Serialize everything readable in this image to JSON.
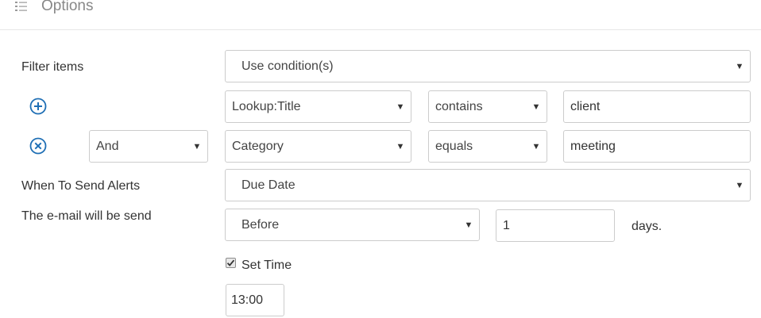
{
  "header": {
    "title": "Options",
    "icon": "list-icon"
  },
  "filter": {
    "label": "Filter items",
    "mode": "Use condition(s)",
    "add_icon": "plus-circle-icon",
    "remove_icon": "x-circle-icon",
    "conditions": [
      {
        "field": "Lookup:Title",
        "operator": "contains",
        "value": "client"
      },
      {
        "join": "And",
        "field": "Category",
        "operator": "equals",
        "value": "meeting"
      }
    ]
  },
  "alerts": {
    "when_label": "When To Send Alerts",
    "when_value": "Due Date",
    "email_label": "The e-mail will be send",
    "timing": "Before",
    "amount": "1",
    "unit": "days."
  },
  "time": {
    "checkbox_label": "Set Time",
    "checked": true,
    "value": "13:00"
  },
  "colors": {
    "accent": "#1f6fb5",
    "border": "#cccccc",
    "text": "#333333"
  }
}
